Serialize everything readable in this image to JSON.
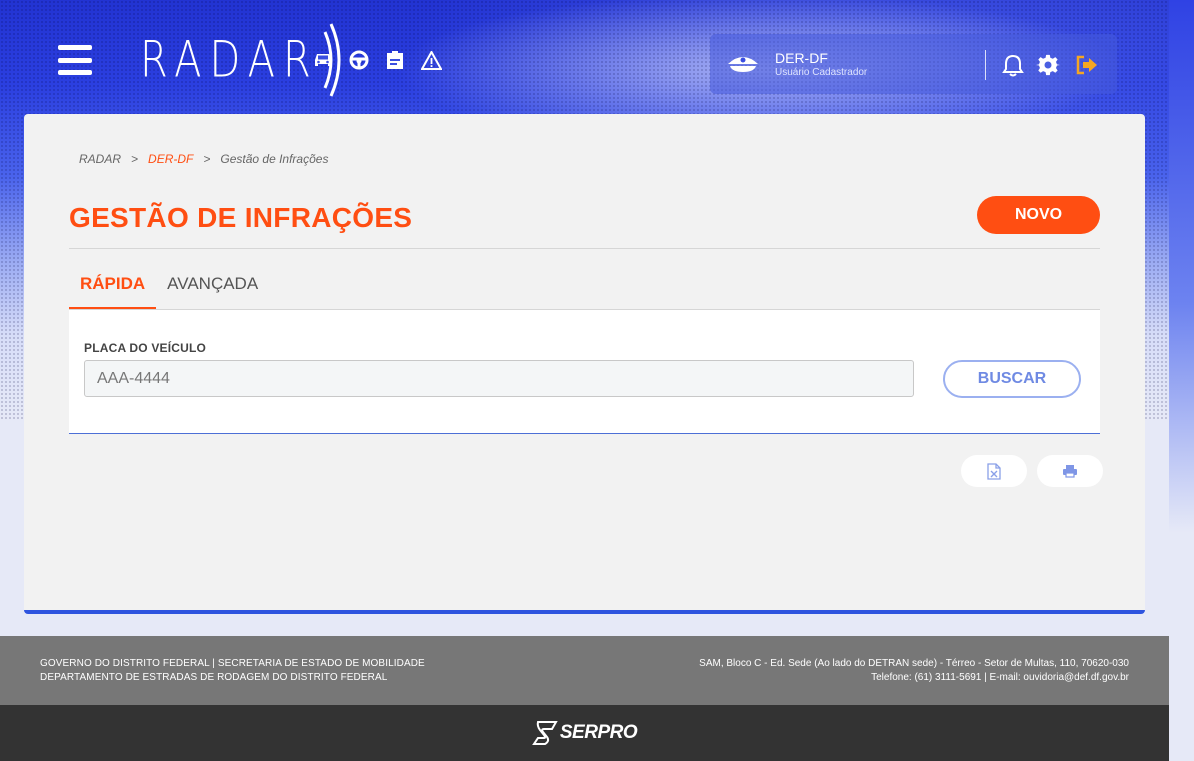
{
  "header": {
    "logo_text": "RADAR",
    "module_icons": [
      "car-icon",
      "steering-wheel-icon",
      "notice-icon",
      "warning-icon"
    ],
    "user": {
      "name": "DER-DF",
      "role": "Usuário Cadastrador"
    },
    "actions": [
      "bell-icon",
      "gear-icon",
      "logout-icon"
    ]
  },
  "breadcrumb": {
    "items": [
      "RADAR",
      "DER-DF",
      "Gestão de Infrações"
    ],
    "separator": ">"
  },
  "page": {
    "title": "GESTÃO DE INFRAÇÕES",
    "new_button": "NOVO"
  },
  "tabs": [
    {
      "label": "RÁPIDA",
      "active": true
    },
    {
      "label": "AVANÇADA",
      "active": false
    }
  ],
  "search": {
    "field_label": "PLACA DO VEÍCULO",
    "placeholder": "AAA-4444",
    "value": "",
    "button_label": "BUSCAR"
  },
  "export_actions": [
    "excel-icon",
    "print-icon"
  ],
  "footer": {
    "left_line1": "GOVERNO DO DISTRITO FEDERAL | SECRETARIA DE ESTADO DE MOBILIDADE",
    "left_line2": "DEPARTAMENTO DE ESTRADAS DE RODAGEM DO DISTRITO FEDERAL",
    "right_line1": "SAM, Bloco C - Ed. Sede (Ao lado do DETRAN sede) - Térreo - Setor de Multas, 110, 70620-030",
    "right_line2": "Telefone: (61) 3111-5691 | E-mail: ouvidoria@def.df.gov.br",
    "brand": "SERPRO"
  },
  "colors": {
    "accent": "#ff4e12",
    "primary_blue": "#2e54df",
    "header_blue": "#2233d2",
    "footer_gray": "#777777",
    "footer_dark": "#333333"
  }
}
